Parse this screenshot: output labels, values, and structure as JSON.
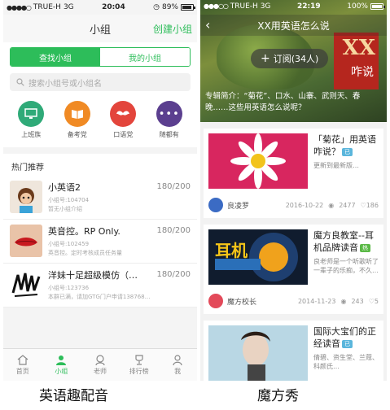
{
  "left": {
    "status": {
      "carrier": "TRUE-H",
      "network": "3G",
      "time": "20:04",
      "battery": "89%",
      "battery_level": 0.89
    },
    "navbar": {
      "title": "小组",
      "action": "创建小组"
    },
    "segments": [
      "查找小组",
      "我的小组"
    ],
    "search_placeholder": "搜索小组号或小组名",
    "categories": [
      {
        "label": "上班族",
        "color": "#2faa78",
        "icon": "monitor-icon"
      },
      {
        "label": "备考党",
        "color": "#f08a24",
        "icon": "book-icon"
      },
      {
        "label": "口语党",
        "color": "#e3453c",
        "icon": "mustache-icon"
      },
      {
        "label": "随都有",
        "color": "#5b3f8f",
        "icon": "more-icon"
      }
    ],
    "hot_title": "热门推荐",
    "groups": [
      {
        "name": "小英语2",
        "id": "小组号:104704",
        "desc": "暂无小组介绍",
        "count": "180/200"
      },
      {
        "name": "英音控。RP Only.",
        "id": "小组号:102459",
        "desc": "英音控。定时考核成员任务量",
        "count": "180/200"
      },
      {
        "name": "洋妹十足超级模仿（…",
        "id": "小组号:123736",
        "desc": "本群已满，请加GTG门户申请138768…",
        "count": "180/200"
      },
      {
        "name": "",
        "id": "",
        "desc": "",
        "count": ""
      }
    ],
    "tabs": [
      {
        "label": "首页",
        "icon": "home-icon"
      },
      {
        "label": "小组",
        "icon": "group-icon"
      },
      {
        "label": "老师",
        "icon": "teacher-icon"
      },
      {
        "label": "排行榜",
        "icon": "trophy-icon"
      },
      {
        "label": "我",
        "icon": "person-icon"
      }
    ],
    "caption": "英语趣配音"
  },
  "right": {
    "status": {
      "carrier": "TRUE-H",
      "network": "3G",
      "time": "22:19",
      "battery": "100%",
      "battery_level": 1.0
    },
    "nav_title": "XX用英语怎么说",
    "subscribe": "订阅(34人)",
    "hero_big": "XX",
    "hero_small": "咋说",
    "intro": "专辑简介：“菊花”、口水、山寨、武则天、春晚……这些用英语怎么说呢？",
    "cards": [
      {
        "title": "「菊花」用英语咋说？",
        "tag": "已",
        "sub": "更新到最新版…",
        "author": "良凌罗",
        "date": "2016-10-22",
        "views": "2477",
        "likes": "186"
      },
      {
        "title": "魔方良教室--耳机品牌读音",
        "tag": "热",
        "sub": "良老师是一个听歌听了一辈子的乐痴，不久…",
        "author": "魔方校长",
        "date": "2014-11-23",
        "views": "243",
        "likes": "5",
        "img_text": "耳机"
      },
      {
        "title": "国际大宝们的正经读音",
        "tag": "已",
        "sub": "倩碧、资生堂、兰蔻、科颜氏…",
        "author": "",
        "date": "",
        "views": "",
        "likes": ""
      }
    ],
    "caption": "魔方秀"
  }
}
